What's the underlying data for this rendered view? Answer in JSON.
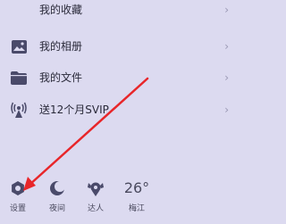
{
  "menu": {
    "items": [
      {
        "label": "我的收藏",
        "icon": "star-icon"
      },
      {
        "label": "我的相册",
        "icon": "photo-icon"
      },
      {
        "label": "我的文件",
        "icon": "folder-icon"
      },
      {
        "label": "送12个月SVIP",
        "icon": "broadcast-icon"
      }
    ],
    "chevron": "›"
  },
  "bottom_bar": {
    "settings_label": "设置",
    "night_label": "夜间",
    "expert_label": "达人",
    "weather_temp": "26°",
    "weather_city": "梅江"
  },
  "colors": {
    "background": "#dcdaf0",
    "icon": "#4a4a6a",
    "arrow": "#e8262a"
  }
}
